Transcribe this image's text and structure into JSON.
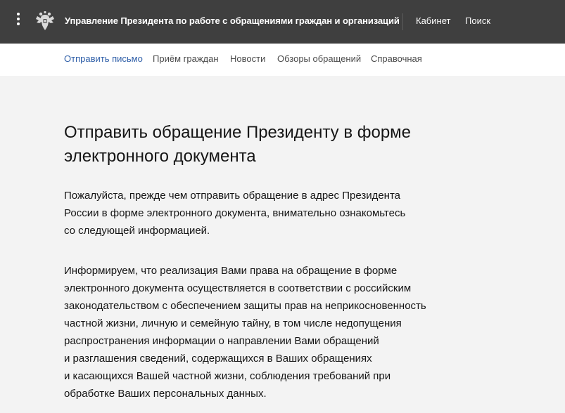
{
  "header": {
    "menu_icon": "vertical-dots-icon",
    "emblem_icon": "coat-of-arms-icon",
    "site_title": "Управление Президента по работе с обращениями граждан и организаций",
    "links": {
      "cabinet": "Кабинет",
      "search": "Поиск"
    },
    "colors": {
      "background": "#3f3f3f",
      "text": "#ffffff"
    }
  },
  "subnav": {
    "items": [
      {
        "label": "Отправить письмо",
        "active": true
      },
      {
        "label": "Приём граждан",
        "active": false
      },
      {
        "label": "Новости",
        "active": false
      },
      {
        "label": "Обзоры обращений",
        "active": false
      },
      {
        "label": "Справочная",
        "active": false
      }
    ],
    "colors": {
      "active": "#2f5fa8",
      "default": "#4a4a4a"
    }
  },
  "main": {
    "title": "Отправить обращение Президенту в форме электронного документа",
    "paragraphs": [
      "Пожалуйста, прежде чем отправить обращение в адрес Президента\nРоссии в форме электронного документа, внимательно ознакомьтесь\nсо следующей информацией.",
      "Информируем, что реализация Вами права на обращение в форме\nэлектронного документа осуществляется в соответствии с российским\nзаконодательством с обеспечением защиты прав на неприкосновенность\nчастной жизни, личную и семейную тайну, в том числе недопущения\nраспространения информации о направлении Вами обращений\nи разглашения сведений, содержащихся в Ваших обращениях\nи касающихся Вашей частной жизни, соблюдения требований при\nобработке Ваших персональных данных."
    ],
    "background": "#f3f3f3"
  }
}
